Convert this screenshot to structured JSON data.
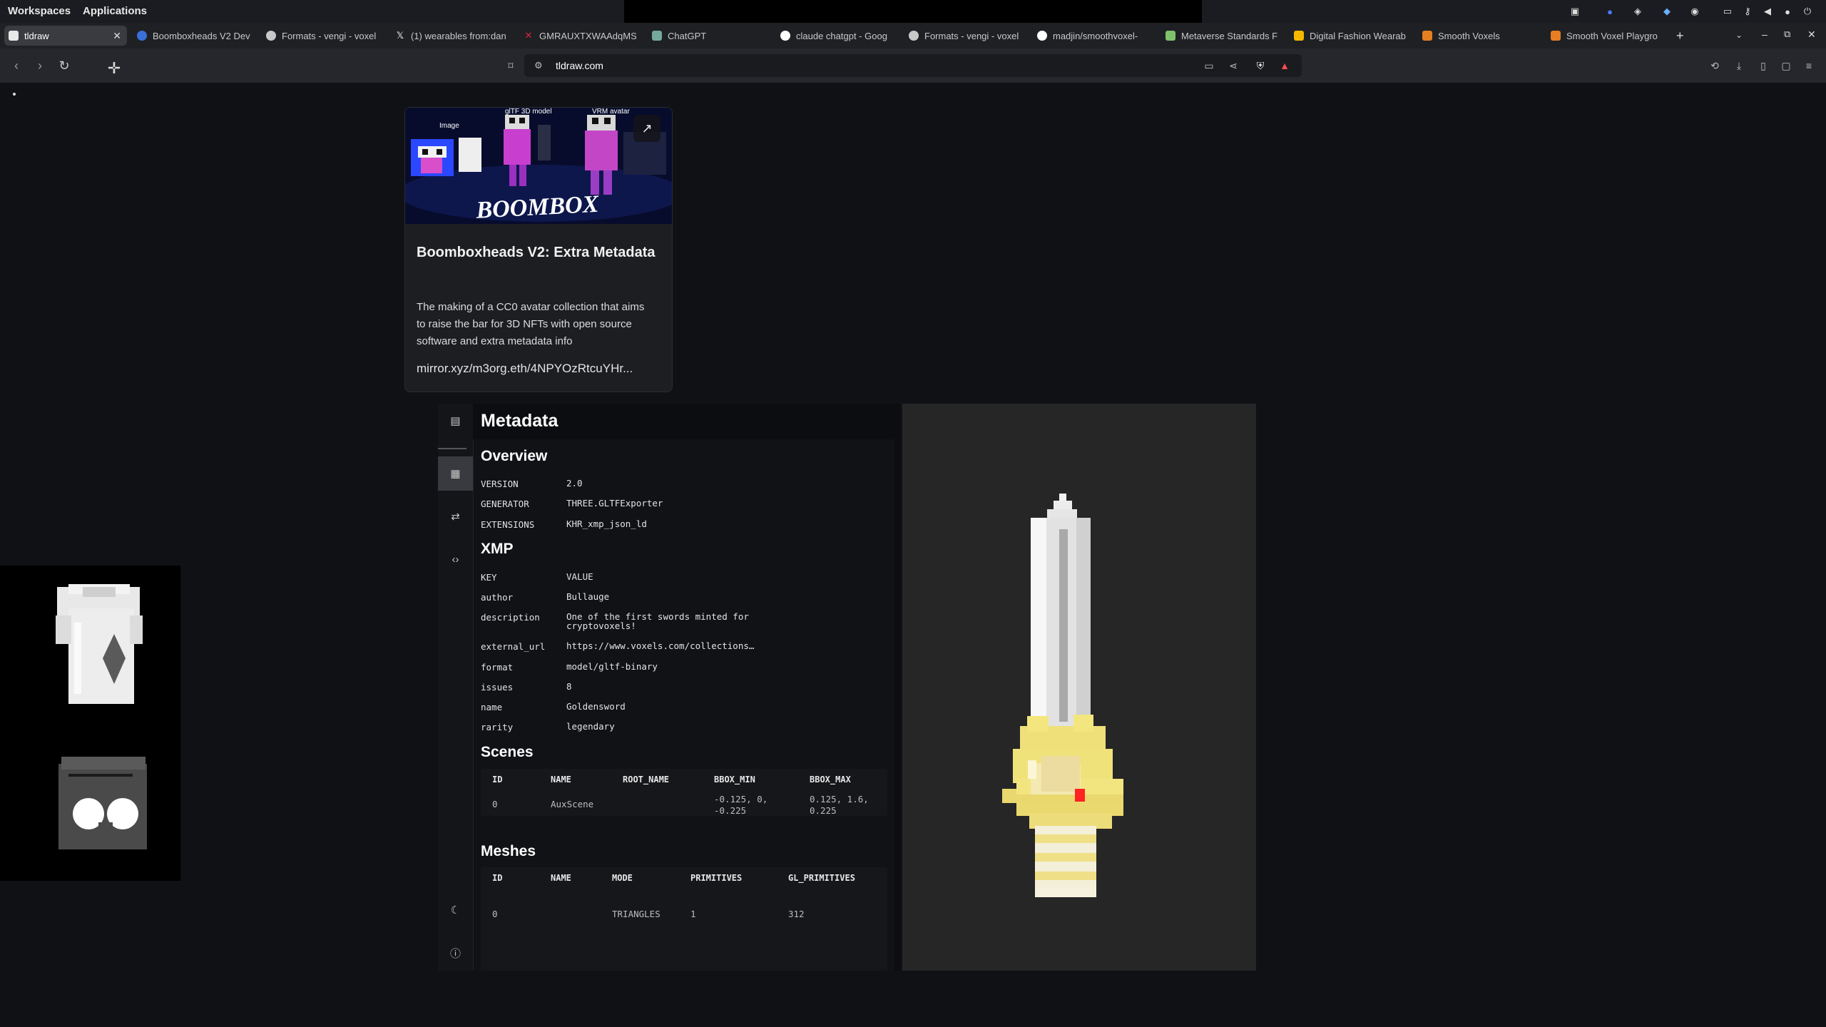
{
  "os": {
    "menu": [
      "Workspaces",
      "Applications"
    ],
    "tray_icons": [
      "screen-icon",
      "zoom-icon",
      "brave-icon",
      "wallet-icon",
      "discord-icon",
      "window-icon",
      "key-icon",
      "volume-icon",
      "mic-icon",
      "power-icon"
    ]
  },
  "tabs": [
    {
      "label": "tldraw",
      "color": "#e8e8e8",
      "active": true
    },
    {
      "label": "Boomboxheads V2 Dev",
      "color": "#3b6fd8"
    },
    {
      "label": "Formats - vengi - voxel",
      "color": "#c8c8c8"
    },
    {
      "label": "(1) wearables from:dan",
      "color": "#111111"
    },
    {
      "label": "GMRAUXTXWAAdqMS (",
      "color": "#d7263d"
    },
    {
      "label": "ChatGPT",
      "color": "#74aa9c"
    },
    {
      "label": "claude chatgpt - Goog",
      "color": "#ffffff"
    },
    {
      "label": "Formats - vengi - voxel",
      "color": "#c8c8c8"
    },
    {
      "label": "madjin/smoothvoxel-",
      "color": "#ffffff"
    },
    {
      "label": "Metaverse Standards F",
      "color": "#7dc36b"
    },
    {
      "label": "Digital Fashion Wearab",
      "color": "#f5b800"
    },
    {
      "label": "Smooth Voxels",
      "color": "#e67e22"
    },
    {
      "label": "Smooth Voxel Playgro",
      "color": "#e67e22"
    }
  ],
  "toolbar": {
    "url": "tldraw.com"
  },
  "card": {
    "image_labels": {
      "image": "Image",
      "gltf": "glTF 3D model",
      "vrm": "VRM avatar"
    },
    "title": "Boomboxheads V2: Extra Metadata",
    "description": "The making of a CC0 avatar collection that aims to raise the bar for 3D NFTs with open source software and extra metadata info",
    "url": "mirror.xyz/m3org.eth/4NPYOzRtcuYHr..."
  },
  "panel": {
    "title": "Metadata",
    "overview": {
      "heading": "Overview",
      "rows": [
        {
          "key": "VERSION",
          "value": "2.0"
        },
        {
          "key": "GENERATOR",
          "value": "THREE.GLTFExporter"
        },
        {
          "key": "EXTENSIONS",
          "value": "KHR_xmp_json_ld"
        }
      ]
    },
    "xmp": {
      "heading": "XMP",
      "header": {
        "key": "KEY",
        "value": "VALUE"
      },
      "rows": [
        {
          "key": "author",
          "value": "Bullauge"
        },
        {
          "key": "description",
          "value": "One of the first swords minted for cryptovoxels!"
        },
        {
          "key": "external_url",
          "value": "https://www.voxels.com/collections…"
        },
        {
          "key": "format",
          "value": "model/gltf-binary"
        },
        {
          "key": "issues",
          "value": "8"
        },
        {
          "key": "name",
          "value": "Goldensword"
        },
        {
          "key": "rarity",
          "value": "legendary"
        }
      ]
    },
    "scenes": {
      "heading": "Scenes",
      "columns": [
        "ID",
        "NAME",
        "ROOT_NAME",
        "BBOX_MIN",
        "BBOX_MAX"
      ],
      "rows": [
        [
          "0",
          "AuxScene",
          "",
          "-0.125, 0, -0.225",
          "0.125, 1.6, 0.225"
        ]
      ]
    },
    "meshes": {
      "heading": "Meshes",
      "columns": [
        "ID",
        "NAME",
        "MODE",
        "PRIMITIVES",
        "GL_PRIMITIVES"
      ],
      "rows": [
        [
          "0",
          "",
          "TRIANGLES",
          "1",
          "312"
        ]
      ]
    }
  }
}
